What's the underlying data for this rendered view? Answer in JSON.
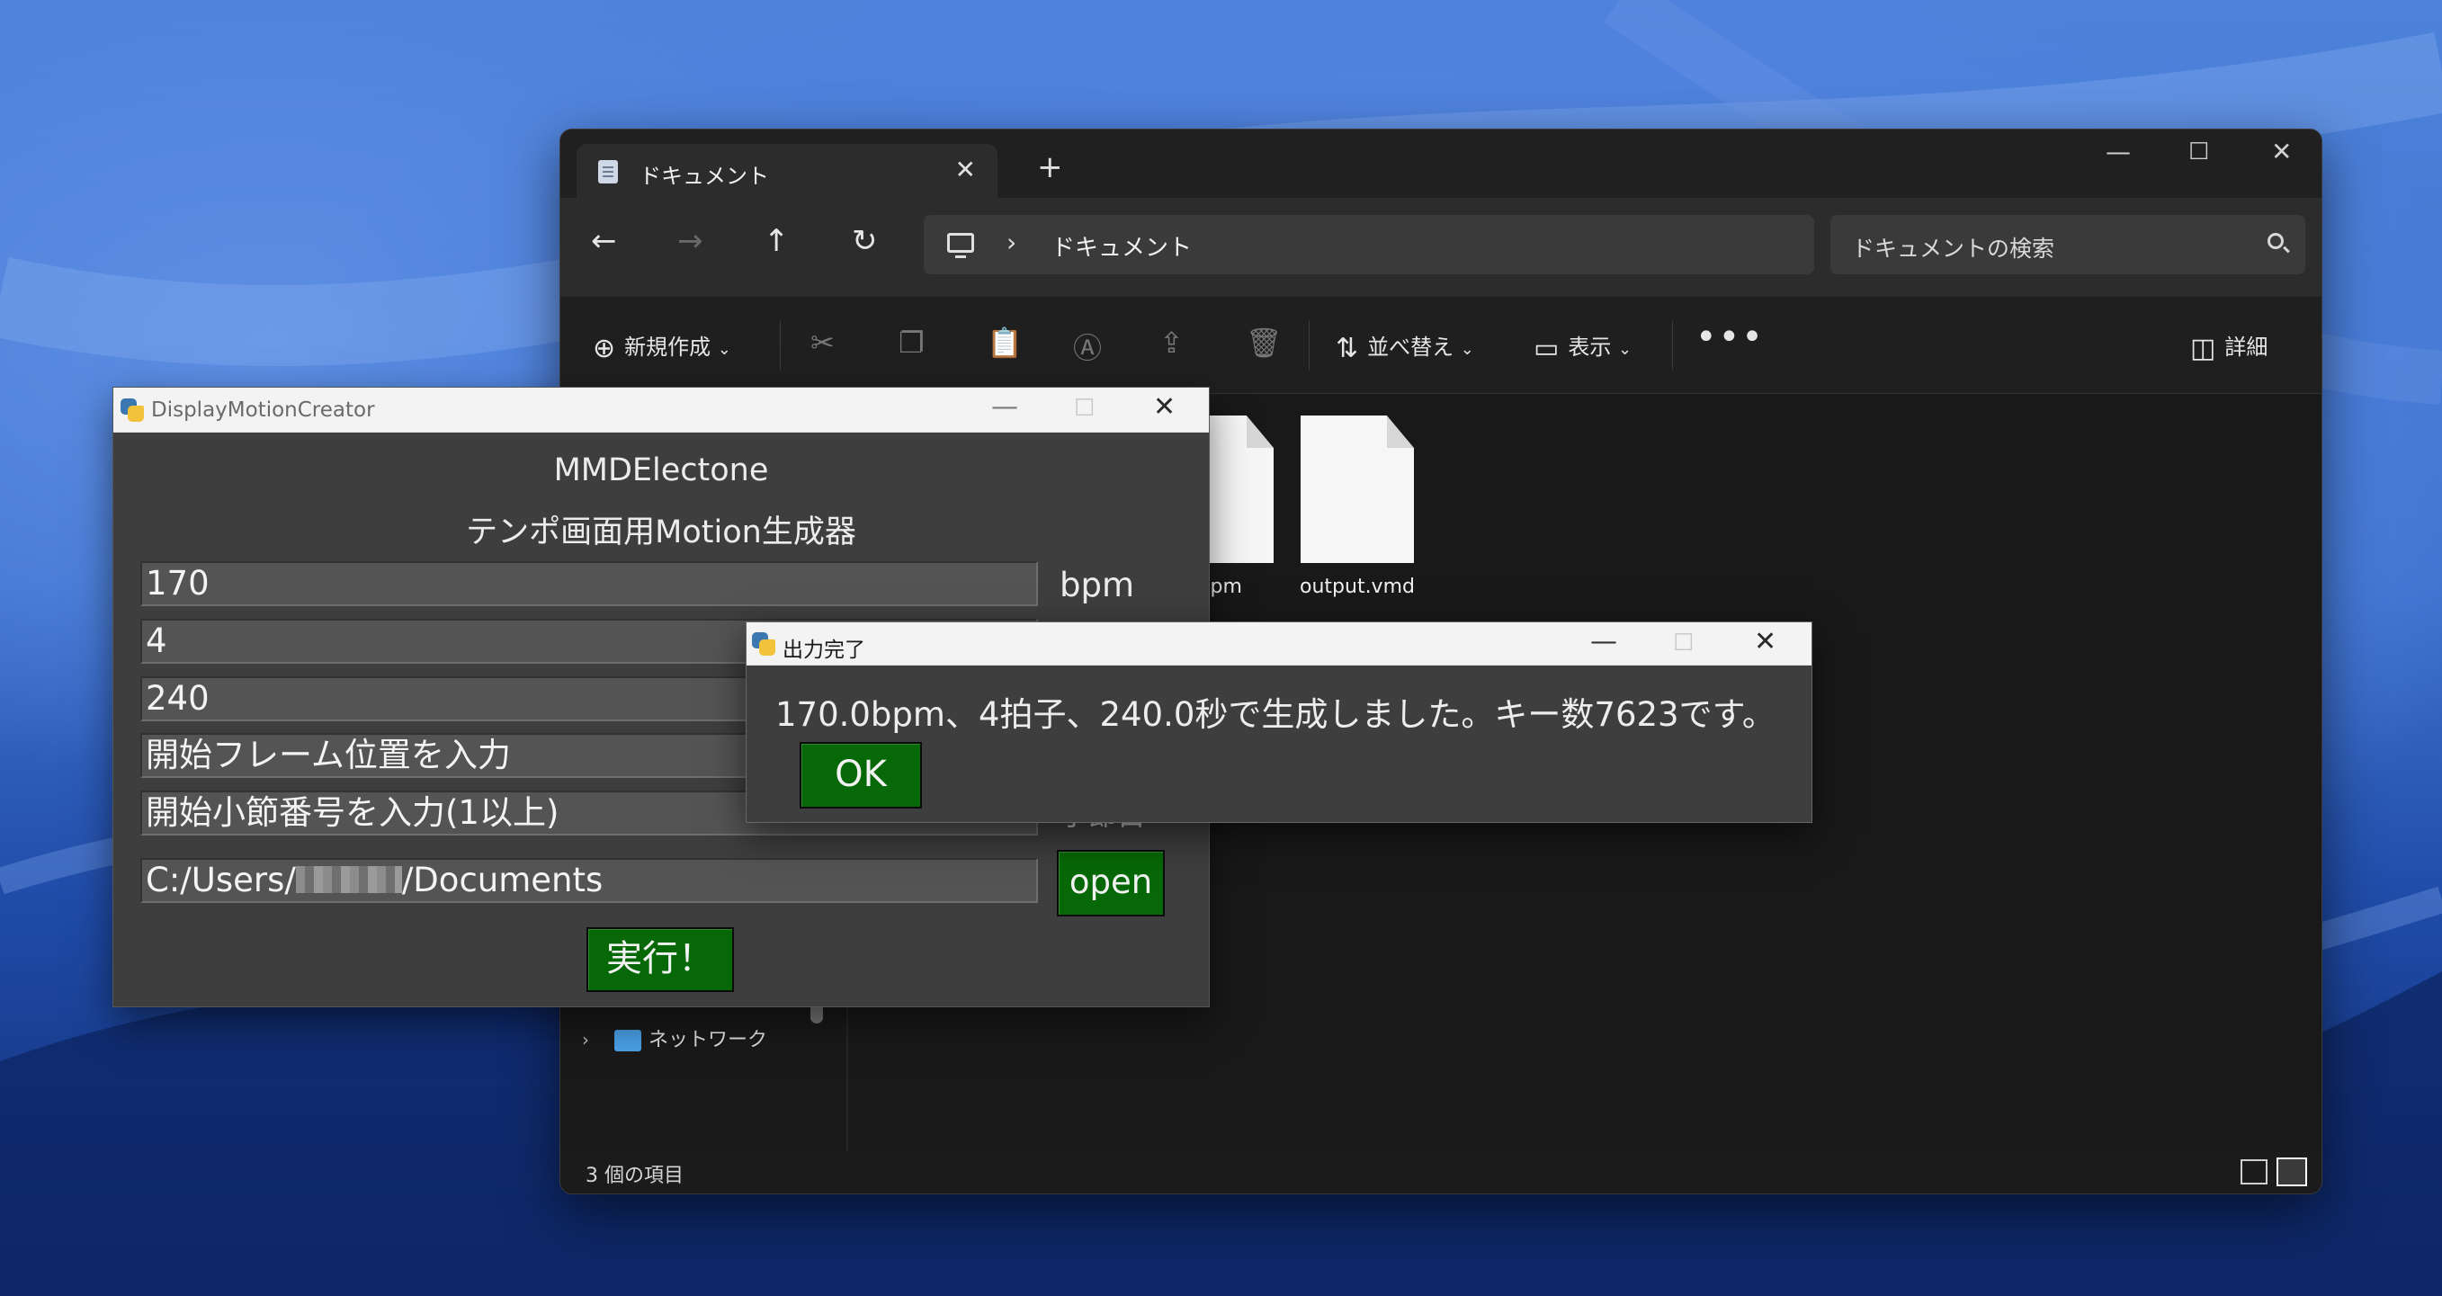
{
  "explorer": {
    "tab_title": "ドキュメント",
    "address_crumb": "ドキュメント",
    "search_placeholder": "ドキュメントの検索",
    "commands": {
      "new": "新規作成",
      "sort": "並べ替え",
      "view": "表示",
      "details": "詳細"
    },
    "files": [
      {
        "name": "a.pm"
      },
      {
        "name": "output.vmd"
      }
    ],
    "nav_network": "ネットワーク",
    "status_count": "3 個の項目"
  },
  "dmc": {
    "window_title": "DisplayMotionCreator",
    "heading": "MMDElectone",
    "subheading": "テンポ画面用Motion生成器",
    "bpm_value": "170",
    "bpm_unit": "bpm",
    "beats_value": "4",
    "seconds_value": "240",
    "start_frame_placeholder": "開始フレーム位置を入力",
    "start_measure_placeholder": "開始小節番号を入力(1以上)",
    "measure_unit_partial": "小節目",
    "path_prefix": "C:/Users/",
    "path_suffix": "/Documents",
    "open_button": "open",
    "run_button": "実行！"
  },
  "dialog": {
    "title": "出力完了",
    "message": "170.0bpm、4拍子、240.0秒で生成しました。キー数7623です。",
    "ok_button": "OK"
  },
  "icons": {
    "tab": "document-icon",
    "back": "arrow-left-icon",
    "forward": "arrow-right-icon",
    "up": "arrow-up-icon",
    "refresh": "refresh-icon",
    "pc": "computer-icon",
    "search": "search-icon",
    "python": "python-icon"
  },
  "colors": {
    "button_green": "#066806",
    "explorer_bg": "#191919",
    "tk_bg": "#3e3e3e"
  }
}
